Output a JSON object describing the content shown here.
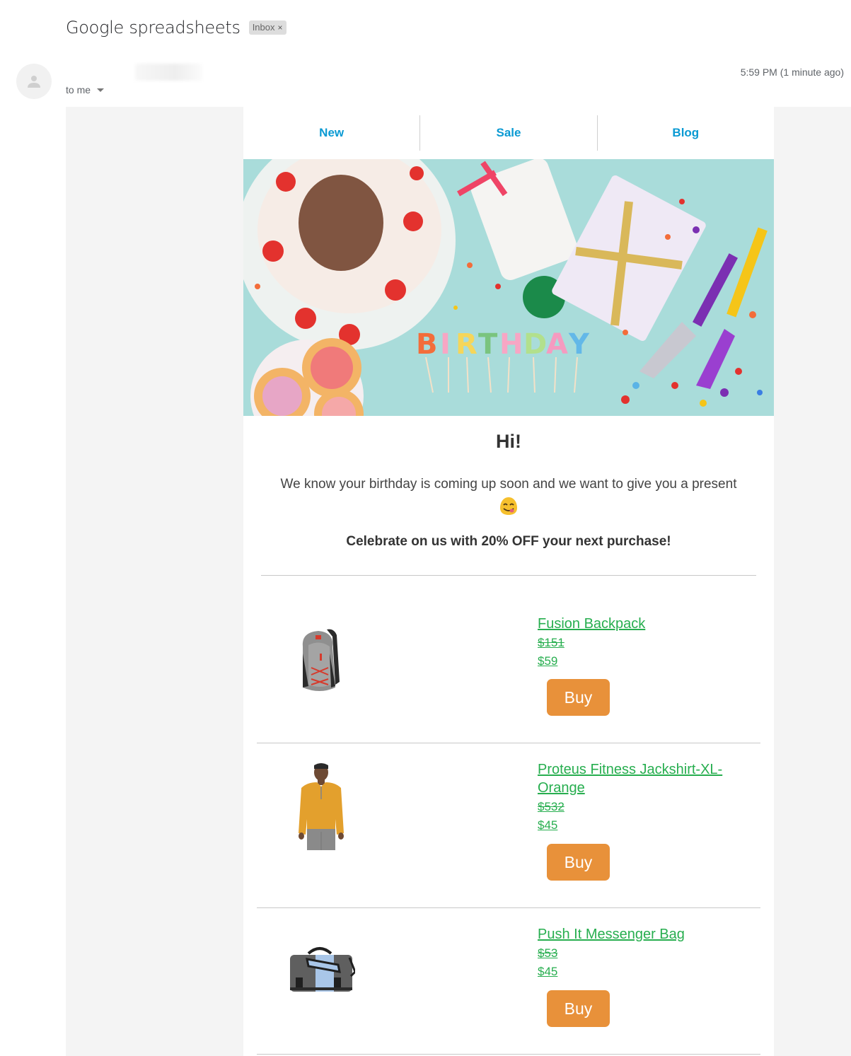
{
  "email": {
    "subject": "Google spreadsheets",
    "label": "Inbox",
    "label_remove": "×",
    "recipient": "to me",
    "timestamp": "5:59 PM (1 minute ago)"
  },
  "newsletter": {
    "nav": [
      {
        "label": "New"
      },
      {
        "label": "Sale"
      },
      {
        "label": "Blog"
      }
    ],
    "hero_alt": "BIRTHDAY",
    "greeting": "Hi!",
    "intro": "We know your birthday is coming up soon and we want to give you a present",
    "emoji": "face-savoring-food",
    "promo": "Celebrate on us with 20% OFF your next purchase!",
    "products": [
      {
        "name": "Fusion Backpack",
        "old_price": "$151",
        "price": "$59",
        "button": "Buy",
        "image": "backpack"
      },
      {
        "name": "Proteus Fitness Jackshirt-XL-Orange",
        "old_price": "$532",
        "price": "$45",
        "button": "Buy",
        "image": "orange-jackshirt"
      },
      {
        "name": "Push It Messenger Bag",
        "old_price": "$53",
        "price": "$45",
        "button": "Buy",
        "image": "messenger-bag"
      }
    ]
  },
  "colors": {
    "nav_link": "#0a9ad3",
    "product_link": "#27ae4f",
    "buy_button": "#e8913a",
    "hero_bg": "#a9dcda"
  }
}
